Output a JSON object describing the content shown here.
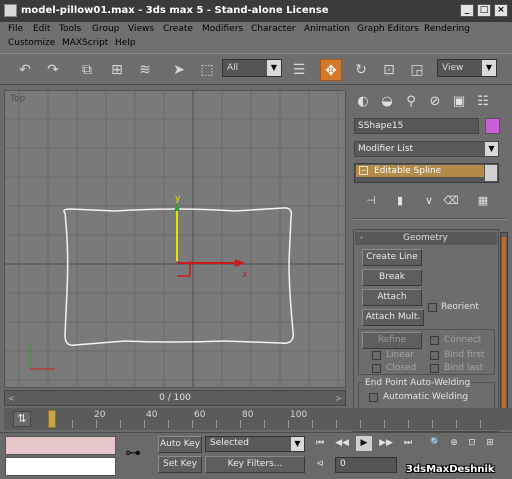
{
  "window": {
    "title": "model-pillow01.max - 3ds max 5 - Stand-alone License",
    "controls": {
      "minimize": "_",
      "maximize": "□",
      "close": "×"
    }
  },
  "menubar": {
    "row1": [
      "File",
      "Edit",
      "Tools",
      "Group",
      "Views",
      "Create",
      "Modifiers",
      "Character",
      "Animation",
      "Graph Editors",
      "Rendering"
    ],
    "row2": [
      "Customize",
      "MAXScript",
      "Help"
    ]
  },
  "toolbar": {
    "selection_filter": "All",
    "reference_coord": "View",
    "icons": [
      "undo-icon",
      "redo-icon",
      "select-and-link-icon",
      "unlink-icon",
      "bind-space-warp-icon",
      "select-arrow-icon",
      "region-select-icon",
      "select-by-name-icon",
      "move-icon",
      "rotate-icon",
      "scale-icon"
    ],
    "active_tool": "move-icon"
  },
  "viewport": {
    "label": "Top",
    "gizmo": {
      "x_axis": "x",
      "y_axis": "y"
    }
  },
  "command_panel": {
    "tabs": [
      "create-tab-icon",
      "modify-tab-icon",
      "hierarchy-tab-icon",
      "motion-tab-icon",
      "display-tab-icon",
      "utilities-tab-icon"
    ],
    "object_name": "SShape15",
    "object_color": "#cc5fd6",
    "modifier_list": "Modifier List",
    "stack_item": "Editable Spline",
    "stack_expander": "⊟",
    "rollout": {
      "title": "Geometry",
      "collapse": "-",
      "create_line": "Create Line",
      "break": "Break",
      "attach": "Attach",
      "reorient": "Reorient",
      "attach_mult": "Attach Mult.",
      "refine": "Refine",
      "connect": "Connect",
      "linear": "Linear",
      "bind_first": "Bind first",
      "closed": "Closed",
      "bind_last": "Bind last",
      "end_point_welding": "End Point Auto-Welding",
      "automatic_welding": "Automatic Welding"
    }
  },
  "time_slider": {
    "label": "0 / 100",
    "left": "<",
    "right": ">"
  },
  "trackbar": {
    "ticks": [
      "20",
      "40",
      "60",
      "80",
      "100"
    ]
  },
  "status": {
    "auto_key": "Auto Key",
    "set_key": "Set Key",
    "selection_set": "Selected",
    "key_filters": "Key Filters...",
    "current_frame": "0"
  },
  "watermark": "3dsMaxDeshnik"
}
